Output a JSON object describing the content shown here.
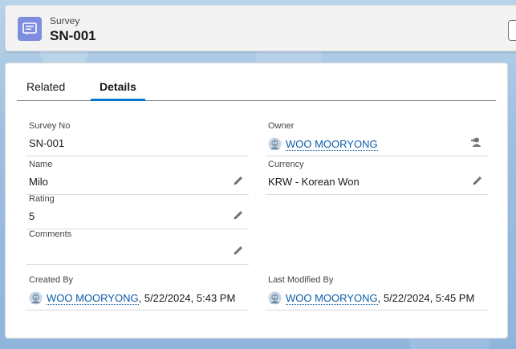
{
  "header": {
    "object_type": "Survey",
    "record_title": "SN-001",
    "icon": "survey-icon",
    "icon_color": "#7f8de1"
  },
  "tabs": [
    {
      "label": "Related",
      "active": false
    },
    {
      "label": "Details",
      "active": true
    }
  ],
  "accent_color": "#0176d3",
  "link_color": "#0b5cab",
  "fields": {
    "survey_no": {
      "label": "Survey No",
      "value": "SN-001"
    },
    "owner": {
      "label": "Owner",
      "value": "WOO MOORYONG"
    },
    "name": {
      "label": "Name",
      "value": "Milo"
    },
    "currency": {
      "label": "Currency",
      "value": "KRW - Korean Won"
    },
    "rating": {
      "label": "Rating",
      "value": "5"
    },
    "comments": {
      "label": "Comments",
      "value": ""
    },
    "created_by": {
      "label": "Created By",
      "user": "WOO MOORYONG",
      "timestamp": ", 5/22/2024, 5:43 PM"
    },
    "last_modified_by": {
      "label": "Last Modified By",
      "user": "WOO MOORYONG",
      "timestamp": ", 5/22/2024, 5:45 PM"
    }
  }
}
